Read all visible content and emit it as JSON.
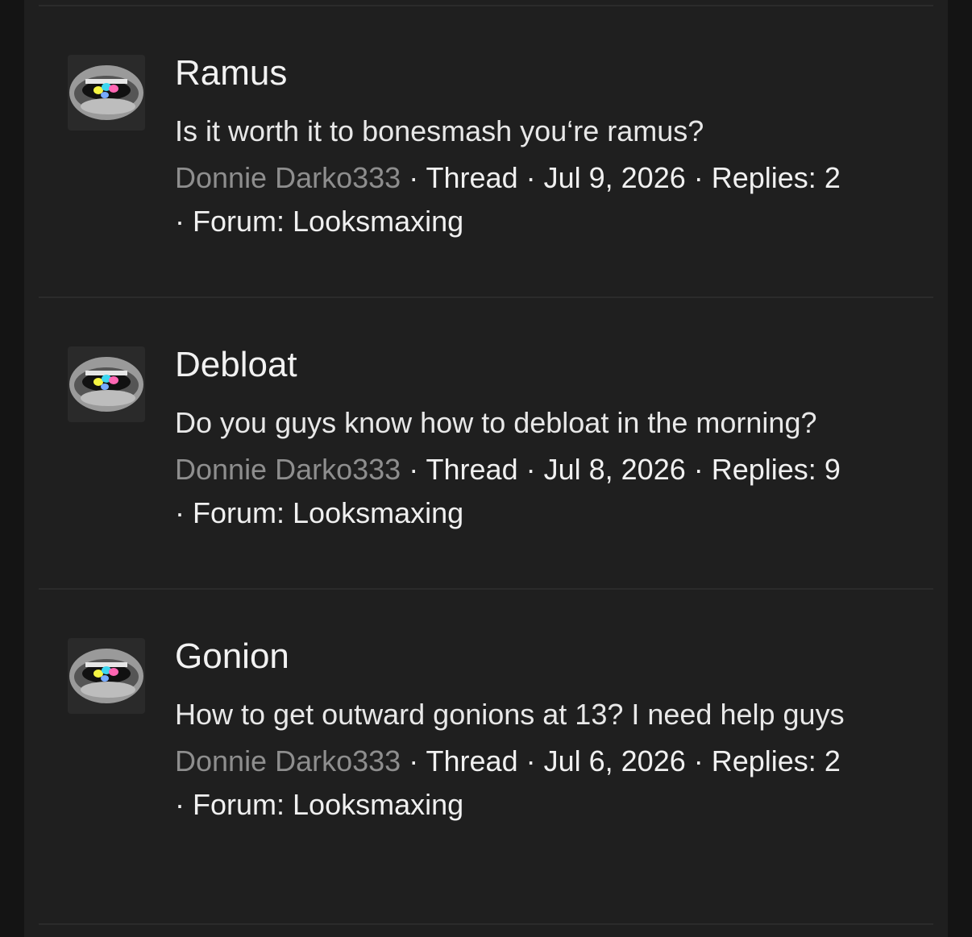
{
  "results": [
    {
      "title": "Ramus",
      "snippet": "Is it worth it to bonesmash you‘re ramus?",
      "author": "Donnie Darko333",
      "type": "Thread",
      "date": "Jul 9, 2026",
      "replies": "Replies: 2",
      "forum_label": "Forum:",
      "forum": "Looksmaxing"
    },
    {
      "title": "Debloat",
      "snippet": "Do you guys know how to debloat in the morning?",
      "author": "Donnie Darko333",
      "type": "Thread",
      "date": "Jul 8, 2026",
      "replies": "Replies: 9",
      "forum_label": "Forum:",
      "forum": "Looksmaxing"
    },
    {
      "title": "Gonion",
      "snippet": "How to get outward gonions at 13? I need help guys",
      "author": "Donnie Darko333",
      "type": "Thread",
      "date": "Jul 6, 2026",
      "replies": "Replies: 2",
      "forum_label": "Forum:",
      "forum": "Looksmaxing"
    }
  ],
  "separator": " · ",
  "colors": {
    "background": "#1f1f1f",
    "author": "#8e8e8e",
    "text": "#f0f0f0"
  },
  "avatar_icon": "avatar-mouth-with-pills"
}
